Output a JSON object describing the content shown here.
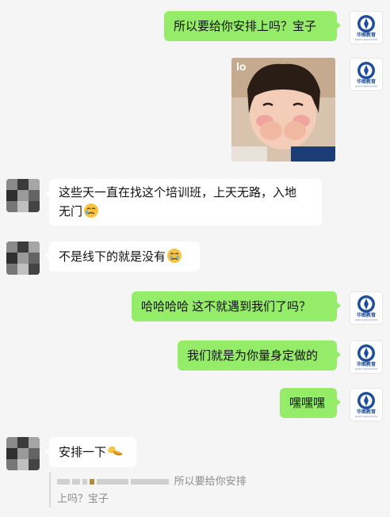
{
  "messages": {
    "m1": {
      "text": "所以要给你安排上吗？宝子",
      "side": "right"
    },
    "m2": {
      "type": "image",
      "side": "right",
      "image_icon": "child-photo-sticker"
    },
    "m3": {
      "text": "这些天一直在找这个培训班，上天无路，入地",
      "text2": "无门",
      "side": "left",
      "emoji_icon": "crying-face-icon"
    },
    "m4": {
      "text": "不是线下的就是没有",
      "side": "left",
      "emoji_icon": "crying-face-icon"
    },
    "m5": {
      "text": "哈哈哈哈 这不就遇到我们了吗？",
      "side": "right"
    },
    "m6": {
      "text": "我们就是为你量身定做的",
      "side": "right"
    },
    "m7": {
      "text": "嘿嘿嘿",
      "side": "right"
    },
    "m8": {
      "text": "安排一下",
      "side": "left",
      "emoji_icon": "bow-emoji-icon"
    }
  },
  "quote": {
    "line1": "所以要给你安排",
    "line2": "上吗？宝子"
  },
  "avatars": {
    "right_logo_cn": "华图教育",
    "right_logo_en": "HUATU EDUCATION"
  },
  "colors": {
    "background": "#f5f5f5",
    "bubble_right": "#95ec69",
    "bubble_left": "#ffffff",
    "logo_blue": "#1f4e9c"
  }
}
